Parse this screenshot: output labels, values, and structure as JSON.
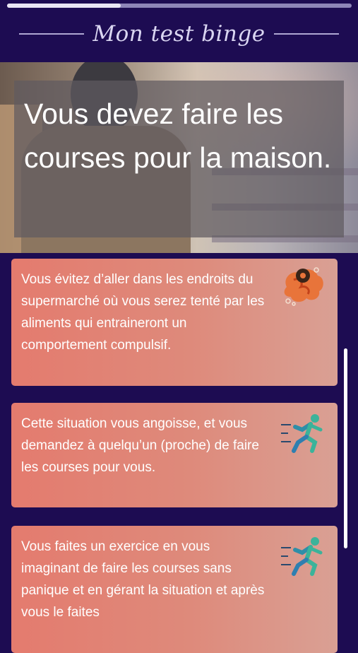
{
  "header": {
    "title": "Mon test binge",
    "progress": 0.33
  },
  "question": {
    "text": "Vous devez faire les courses pour la maison."
  },
  "answers": [
    {
      "text": "Vous évitez d’aller dans les endroits du supermarché où vous serez tenté par les aliments qui entraineront un comportement compulsif.",
      "icon": "brain-gear-icon"
    },
    {
      "text": "Cette situation vous angoisse, et vous demandez à quelqu’un (proche) de faire les courses pour vous.",
      "icon": "running-person-icon"
    },
    {
      "text": "Vous faites un exercice en vous imaginant de faire les courses sans panique et en gérant la situation et après vous le faites",
      "icon": "running-person-icon"
    }
  ],
  "colors": {
    "background": "#1d0c52",
    "card": "#e47b6e",
    "title": "#d9d5f1"
  }
}
